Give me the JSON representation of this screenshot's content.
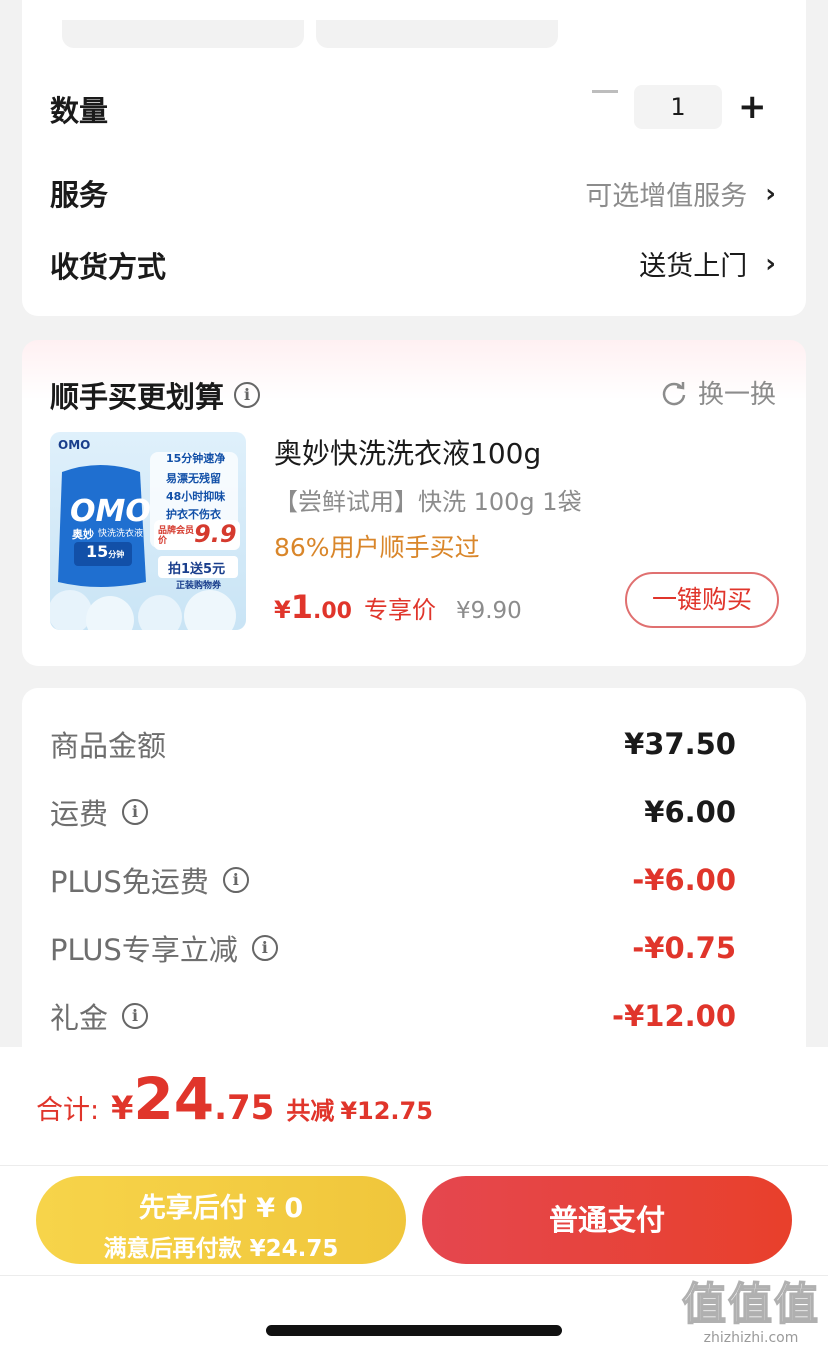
{
  "options": {
    "quantity_label": "数量",
    "quantity_value": "1",
    "service_label": "服务",
    "service_value": "可选增值服务",
    "delivery_label": "收货方式",
    "delivery_value": "送货上门"
  },
  "addon": {
    "title": "顺手买更划算",
    "swap_label": "换一换",
    "product": {
      "name": "奥妙快洗洗衣液100g",
      "spec": "【尝鲜试用】快洗 100g 1袋",
      "purchase_rate": "86%用户顺手买过",
      "price_currency": "¥",
      "price_int": "1",
      "price_dec": ".00",
      "price_tag": "专享价",
      "original_price": "¥9.90",
      "buy_button": "一键购买",
      "image": {
        "brand": "OMO",
        "brand_cn": "奥妙",
        "product_type": "快洗洗衣液",
        "badge_15": "15",
        "badge_15_unit": "分钟",
        "bullets": [
          "15分钟速净",
          "易漂无残留",
          "48小时抑味",
          "护衣不伤衣"
        ],
        "member_price_label": "品牌会员价",
        "member_price": "9.9",
        "promo": "拍1送5元",
        "promo_sub": "正装购物券"
      }
    }
  },
  "summary": {
    "rows": [
      {
        "label": "商品金额",
        "value": "¥37.50",
        "info": false,
        "red": false
      },
      {
        "label": "运费",
        "value": "¥6.00",
        "info": true,
        "red": false
      },
      {
        "label": "PLUS免运费",
        "value": "-¥6.00",
        "info": true,
        "red": true
      },
      {
        "label": "PLUS专享立减",
        "value": "-¥0.75",
        "info": true,
        "red": true
      },
      {
        "label": "礼金",
        "value": "-¥12.00",
        "info": true,
        "red": true
      }
    ]
  },
  "checkout": {
    "total_label": "合计:",
    "total_currency": "¥",
    "total_int": "24",
    "total_dec": ".75",
    "saved_label": "共减",
    "saved_value": "¥12.75",
    "pay_later_title": "先享后付 ¥ 0",
    "pay_later_sub": "满意后再付款 ¥24.75",
    "pay_button": "普通支付"
  },
  "watermark": {
    "logo_text": "值值值",
    "url": "zhizhizhi.com"
  },
  "colors": {
    "accent_red": "#e0352b",
    "orange_text": "#d9862a",
    "pay_later_yellow": "#f3cc42",
    "background": "#f2f2f2"
  }
}
